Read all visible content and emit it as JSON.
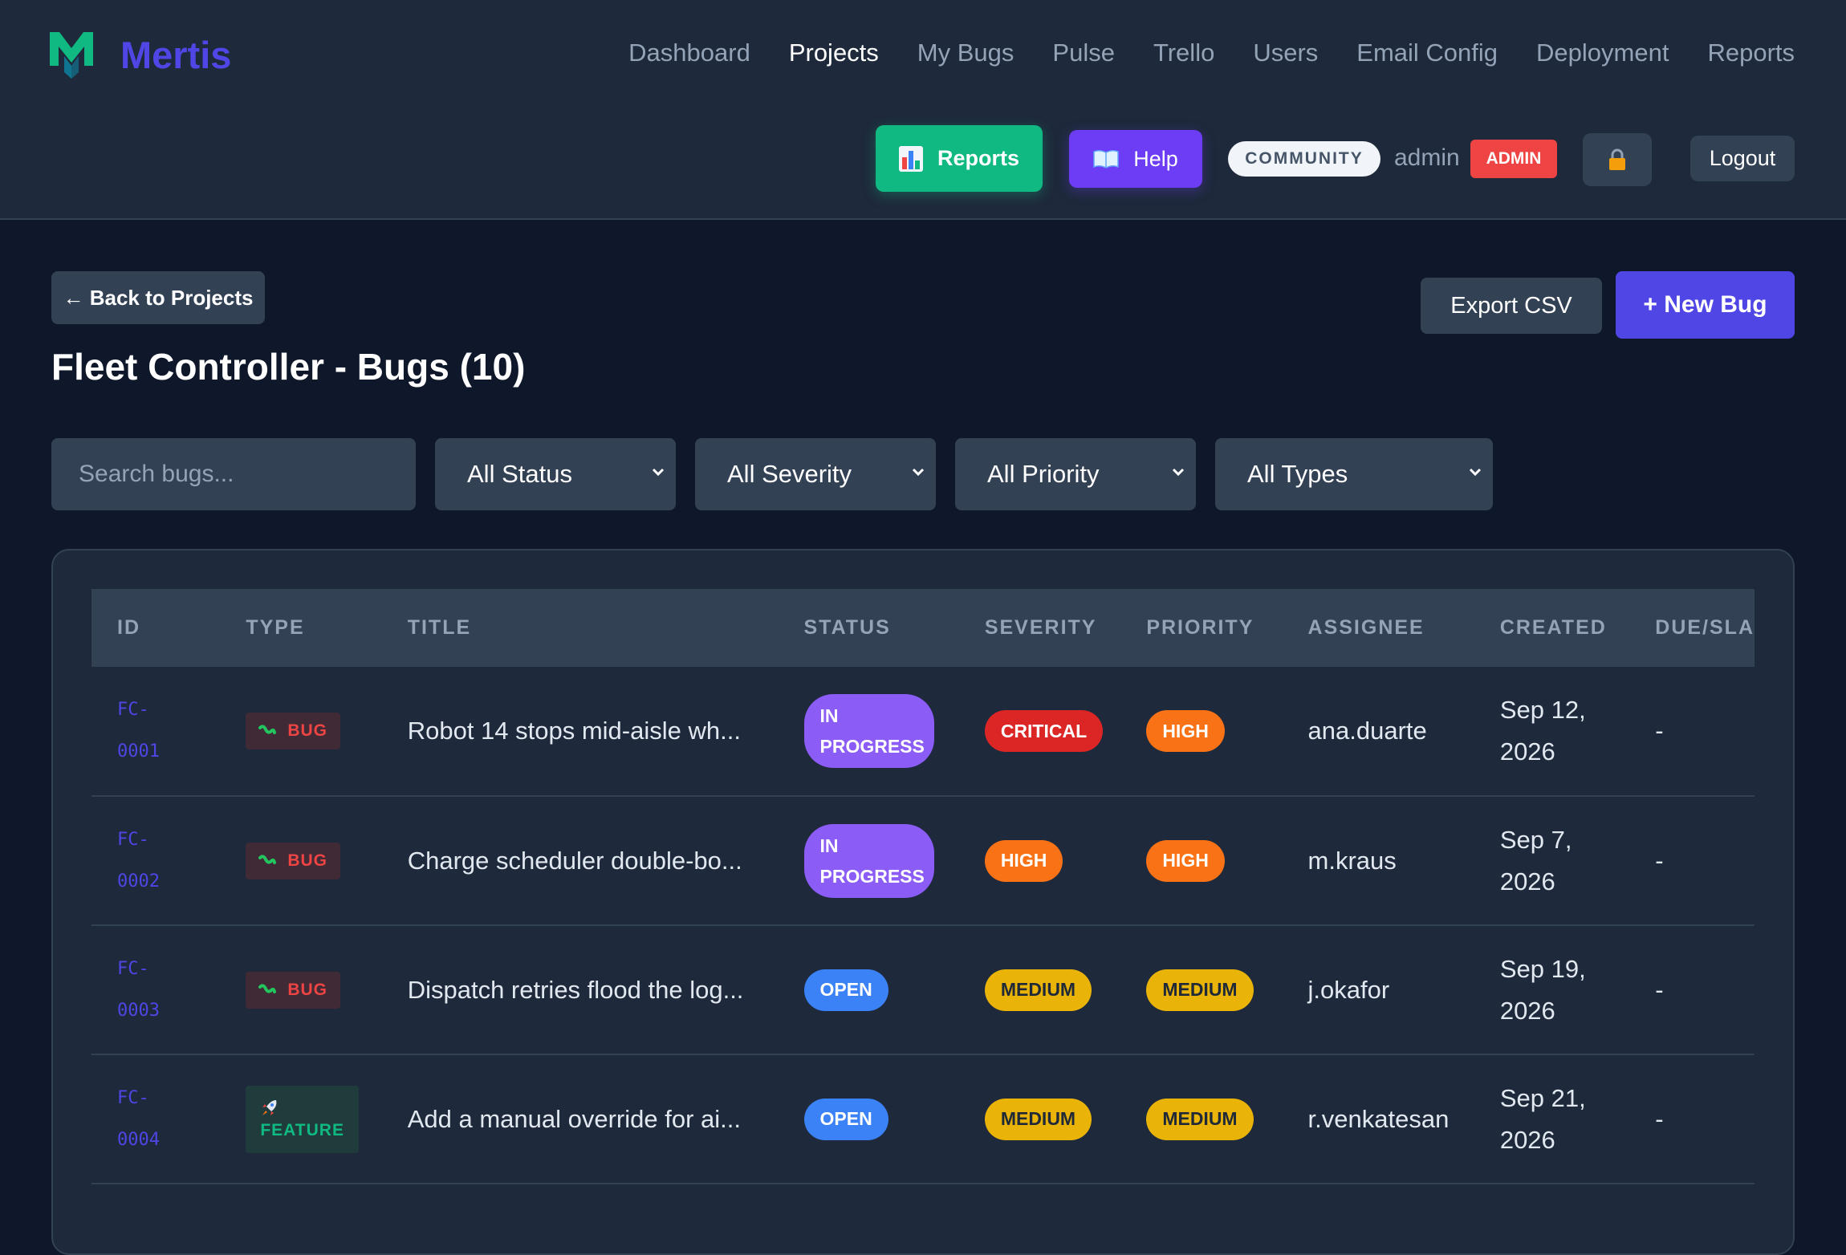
{
  "brand": {
    "name": "Mertis"
  },
  "nav": [
    "Dashboard",
    "Projects",
    "My Bugs",
    "Pulse",
    "Trello",
    "Users",
    "Email Config",
    "Deployment",
    "Reports"
  ],
  "header": {
    "reports_label": "Reports",
    "help_label": "Help",
    "edition": "COMMUNITY",
    "username": "admin",
    "role": "ADMIN",
    "logout_label": "Logout"
  },
  "toolbar": {
    "back_label": "← Back to Projects",
    "title": "Fleet Controller - Bugs (10)",
    "export_label": "Export CSV",
    "new_label": "+ New Bug",
    "search_placeholder": "Search bugs...",
    "filters": [
      "All Status",
      "All Severity",
      "All Priority",
      "All Types"
    ]
  },
  "table": {
    "columns": [
      "ID",
      "TYPE",
      "TITLE",
      "STATUS",
      "SEVERITY",
      "PRIORITY",
      "ASSIGNEE",
      "CREATED",
      "DUE/SLA"
    ],
    "rows": [
      {
        "id1": "FC-",
        "id2": "0001",
        "type": "BUG",
        "type_icon": "bug-icon",
        "title": "Robot 14 stops mid-aisle wh...",
        "status1": "IN",
        "status2": "PROGRESS",
        "severity": "CRITICAL",
        "priority": "HIGH",
        "assignee": "ana.duarte",
        "date1": "Sep 12,",
        "date2": "2026",
        "due": "-"
      },
      {
        "id1": "FC-",
        "id2": "0002",
        "type": "BUG",
        "type_icon": "bug-icon",
        "title": "Charge scheduler double-bo...",
        "status1": "IN",
        "status2": "PROGRESS",
        "severity": "HIGH",
        "priority": "HIGH",
        "assignee": "m.kraus",
        "date1": "Sep 7,",
        "date2": "2026",
        "due": "-"
      },
      {
        "id1": "FC-",
        "id2": "0003",
        "type": "BUG",
        "type_icon": "bug-icon",
        "title": "Dispatch retries flood the log...",
        "status": "OPEN",
        "severity": "MEDIUM",
        "priority": "MEDIUM",
        "assignee": "j.okafor",
        "date1": "Sep 19,",
        "date2": "2026",
        "due": "-"
      },
      {
        "id1": "FC-",
        "id2": "0004",
        "type": "FEATURE",
        "type_icon": "rocket-icon",
        "title": "Add a manual override for ai...",
        "status": "OPEN",
        "severity": "MEDIUM",
        "priority": "MEDIUM",
        "assignee": "r.venkatesan",
        "date1": "Sep 21,",
        "date2": "2026",
        "due": "-"
      }
    ]
  }
}
